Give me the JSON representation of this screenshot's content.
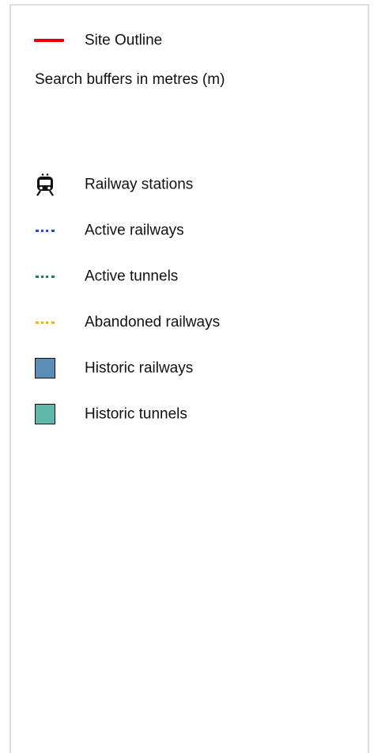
{
  "legend": {
    "site_outline": {
      "label": "Site Outline",
      "color": "#e60000"
    },
    "search_buffers_label": "Search buffers in metres (m)",
    "items": [
      {
        "label": "Railway stations",
        "icon": "train-icon"
      },
      {
        "label": "Active railways",
        "icon": "dotted-line",
        "color": "#1f4fcf"
      },
      {
        "label": "Active tunnels",
        "icon": "dotted-line",
        "color": "#1c7f5a"
      },
      {
        "label": "Abandoned railways",
        "icon": "dotted-line",
        "color": "#f2b600"
      },
      {
        "label": "Historic railways",
        "icon": "fill-swatch",
        "color": "#5b8db8"
      },
      {
        "label": "Historic tunnels",
        "icon": "fill-swatch",
        "color": "#5fb7a9"
      }
    ]
  }
}
